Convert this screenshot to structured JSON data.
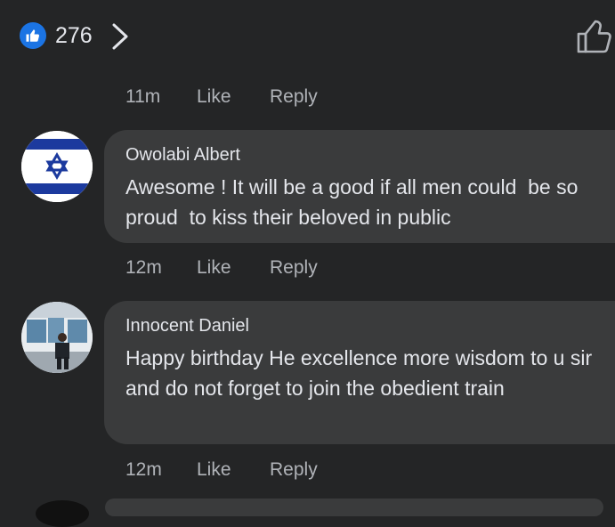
{
  "reactions": {
    "count": "276",
    "icon": "like-thumb-icon",
    "accent_color": "#1b74e4"
  },
  "meta_top": {
    "time": "11m",
    "like_label": "Like",
    "reply_label": "Reply"
  },
  "comments": [
    {
      "author": "Owolabi Albert",
      "text": "Awesome ! It will be a good if all men could  be so  proud  to kiss their beloved in public",
      "avatar": "israel-flag-avatar",
      "time": "12m",
      "like_label": "Like",
      "reply_label": "Reply"
    },
    {
      "author": "Innocent Daniel",
      "text": "Happy birthday He excellence more wisdom to u sir and do not forget to join the obedient train",
      "avatar": "photo-avatar",
      "time": "12m",
      "like_label": "Like",
      "reply_label": "Reply"
    }
  ]
}
